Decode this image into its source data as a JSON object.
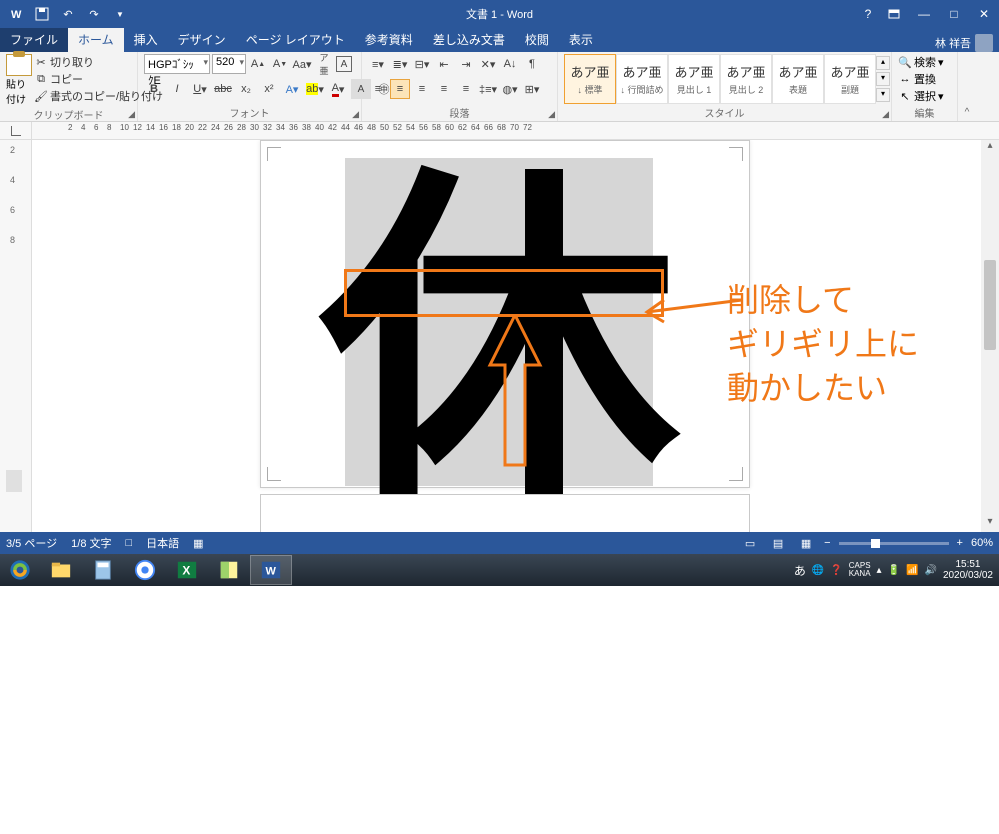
{
  "window": {
    "title": "文書 1 - Word",
    "user": "林 祥吾"
  },
  "tabs": {
    "file": "ファイル",
    "home": "ホーム",
    "insert": "挿入",
    "design": "デザイン",
    "layout": "ページ レイアウト",
    "references": "参考資料",
    "mailings": "差し込み文書",
    "review": "校閲",
    "view": "表示"
  },
  "ribbon": {
    "clipboard": {
      "label": "クリップボード",
      "paste": "貼り付け",
      "cut": "切り取り",
      "copy": "コピー",
      "formatpainter": "書式のコピー/貼り付け"
    },
    "font": {
      "label": "フォント",
      "name": "HGPｺﾞｼｯｸE",
      "size": "520"
    },
    "paragraph": {
      "label": "段落"
    },
    "styles": {
      "label": "スタイル",
      "items": [
        {
          "sample": "あア亜",
          "name": "↓ 標準"
        },
        {
          "sample": "あア亜",
          "name": "↓ 行間詰め"
        },
        {
          "sample": "あア亜",
          "name": "見出し 1"
        },
        {
          "sample": "あア亜",
          "name": "見出し 2"
        },
        {
          "sample": "あア亜",
          "name": "表題"
        },
        {
          "sample": "あア亜",
          "name": "副題"
        }
      ]
    },
    "editing": {
      "label": "編集",
      "find": "検索",
      "replace": "置換",
      "select": "選択"
    }
  },
  "document": {
    "big_char": "休"
  },
  "annotation": {
    "line1": "削除して",
    "line2": "ギリギリ上に",
    "line3": "動かしたい"
  },
  "statusbar": {
    "page": "3/5 ページ",
    "words": "1/8 文字",
    "lang": "日本語",
    "zoom": "60%"
  },
  "taskbar": {
    "ime": "あ",
    "caps": "CAPS",
    "kana": "KANA",
    "time": "15:51",
    "date": "2020/03/02"
  },
  "ruler_numbers": [
    2,
    4,
    6,
    8,
    10,
    12,
    14,
    16,
    18,
    20,
    22,
    24,
    26,
    28,
    30,
    32,
    34,
    36,
    38,
    40,
    42,
    44,
    46,
    48,
    50,
    52,
    54,
    56,
    58,
    60,
    62,
    64,
    66,
    68,
    70,
    72
  ]
}
